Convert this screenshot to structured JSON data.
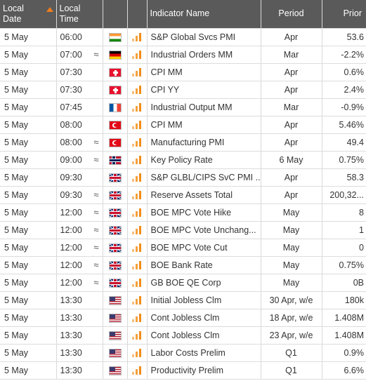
{
  "header": {
    "local_date": [
      "Local",
      "Date"
    ],
    "local_time": [
      "Local",
      "Time"
    ],
    "indicator_name": "Indicator Name",
    "period": "Period",
    "prior": "Prior"
  },
  "colors": {
    "accent": "#f07d1c",
    "header_bg": "#e9e9e9",
    "sorted_header_bg": "#5a5a5a"
  },
  "rows": [
    {
      "date": "5 May",
      "time": "06:00",
      "approx": "",
      "country": "india",
      "name": "S&P Global Svcs PMI",
      "period": "Apr",
      "prior": "53.6"
    },
    {
      "date": "5 May",
      "time": "07:00",
      "approx": "≈",
      "country": "germany",
      "name": "Industrial Orders MM",
      "period": "Mar",
      "prior": "-2.2%"
    },
    {
      "date": "5 May",
      "time": "07:30",
      "approx": "",
      "country": "switzerland",
      "name": "CPI MM",
      "period": "Apr",
      "prior": "0.6%"
    },
    {
      "date": "5 May",
      "time": "07:30",
      "approx": "",
      "country": "switzerland",
      "name": "CPI YY",
      "period": "Apr",
      "prior": "2.4%"
    },
    {
      "date": "5 May",
      "time": "07:45",
      "approx": "",
      "country": "france",
      "name": "Industrial Output MM",
      "period": "Mar",
      "prior": "-0.9%"
    },
    {
      "date": "5 May",
      "time": "08:00",
      "approx": "",
      "country": "turkey",
      "name": "CPI MM",
      "period": "Apr",
      "prior": "5.46%"
    },
    {
      "date": "5 May",
      "time": "08:00",
      "approx": "≈",
      "country": "turkey",
      "name": "Manufacturing PMI",
      "period": "Apr",
      "prior": "49.4"
    },
    {
      "date": "5 May",
      "time": "09:00",
      "approx": "≈",
      "country": "norway",
      "name": "Key Policy Rate",
      "period": "6 May",
      "prior": "0.75%"
    },
    {
      "date": "5 May",
      "time": "09:30",
      "approx": "",
      "country": "uk",
      "name": "S&P GLBL/CIPS SvC PMI ...",
      "period": "Apr",
      "prior": "58.3"
    },
    {
      "date": "5 May",
      "time": "09:30",
      "approx": "≈",
      "country": "uk",
      "name": "Reserve Assets Total",
      "period": "Apr",
      "prior": "200,32..."
    },
    {
      "date": "5 May",
      "time": "12:00",
      "approx": "≈",
      "country": "uk",
      "name": "BOE MPC Vote Hike",
      "period": "May",
      "prior": "8"
    },
    {
      "date": "5 May",
      "time": "12:00",
      "approx": "≈",
      "country": "uk",
      "name": "BOE MPC Vote Unchang...",
      "period": "May",
      "prior": "1"
    },
    {
      "date": "5 May",
      "time": "12:00",
      "approx": "≈",
      "country": "uk",
      "name": "BOE MPC Vote Cut",
      "period": "May",
      "prior": "0"
    },
    {
      "date": "5 May",
      "time": "12:00",
      "approx": "≈",
      "country": "uk",
      "name": "BOE Bank Rate",
      "period": "May",
      "prior": "0.75%"
    },
    {
      "date": "5 May",
      "time": "12:00",
      "approx": "≈",
      "country": "uk",
      "name": "GB BOE QE Corp",
      "period": "May",
      "prior": "0B"
    },
    {
      "date": "5 May",
      "time": "13:30",
      "approx": "",
      "country": "us",
      "name": "Initial Jobless Clm",
      "period": "30 Apr, w/e",
      "prior": "180k"
    },
    {
      "date": "5 May",
      "time": "13:30",
      "approx": "",
      "country": "us",
      "name": "Cont Jobless Clm",
      "period": "18 Apr, w/e",
      "prior": "1.408M"
    },
    {
      "date": "5 May",
      "time": "13:30",
      "approx": "",
      "country": "us",
      "name": "Cont Jobless Clm",
      "period": "23 Apr, w/e",
      "prior": "1.408M"
    },
    {
      "date": "5 May",
      "time": "13:30",
      "approx": "",
      "country": "us",
      "name": "Labor Costs Prelim",
      "period": "Q1",
      "prior": "0.9%"
    },
    {
      "date": "5 May",
      "time": "13:30",
      "approx": "",
      "country": "us",
      "name": "Productivity Prelim",
      "period": "Q1",
      "prior": "6.6%"
    }
  ]
}
